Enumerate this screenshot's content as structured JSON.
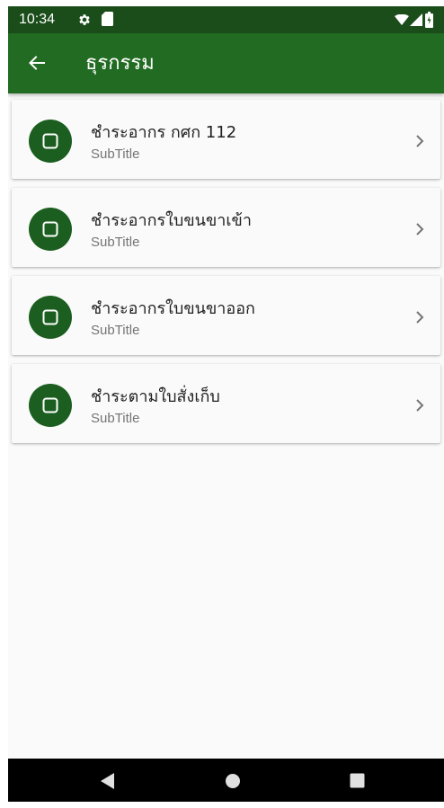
{
  "status_bar": {
    "time": "10:34",
    "icons": [
      "gear-icon",
      "sd-card-icon",
      "wifi-icon",
      "signal-icon",
      "battery-icon"
    ]
  },
  "app_bar": {
    "title": "ธุรกรรม",
    "back_icon": "arrow-left-icon",
    "color": "#226b22"
  },
  "list": {
    "items": [
      {
        "title": "ชำระอากร กศก 112",
        "subtitle": "SubTitle",
        "icon": "square-icon"
      },
      {
        "title": "ชำระอากรใบขนขาเข้า",
        "subtitle": "SubTitle",
        "icon": "square-icon"
      },
      {
        "title": "ชำระอากรใบขนขาออก",
        "subtitle": "SubTitle",
        "icon": "square-icon"
      },
      {
        "title": "ชำระตามใบสั่งเก็บ",
        "subtitle": "SubTitle",
        "icon": "square-icon"
      }
    ],
    "avatar_color": "#1b5e20",
    "trailing_icon": "chevron-right-icon"
  },
  "nav_bar": {
    "buttons": [
      "back-triangle-icon",
      "home-circle-icon",
      "recents-square-icon"
    ]
  }
}
